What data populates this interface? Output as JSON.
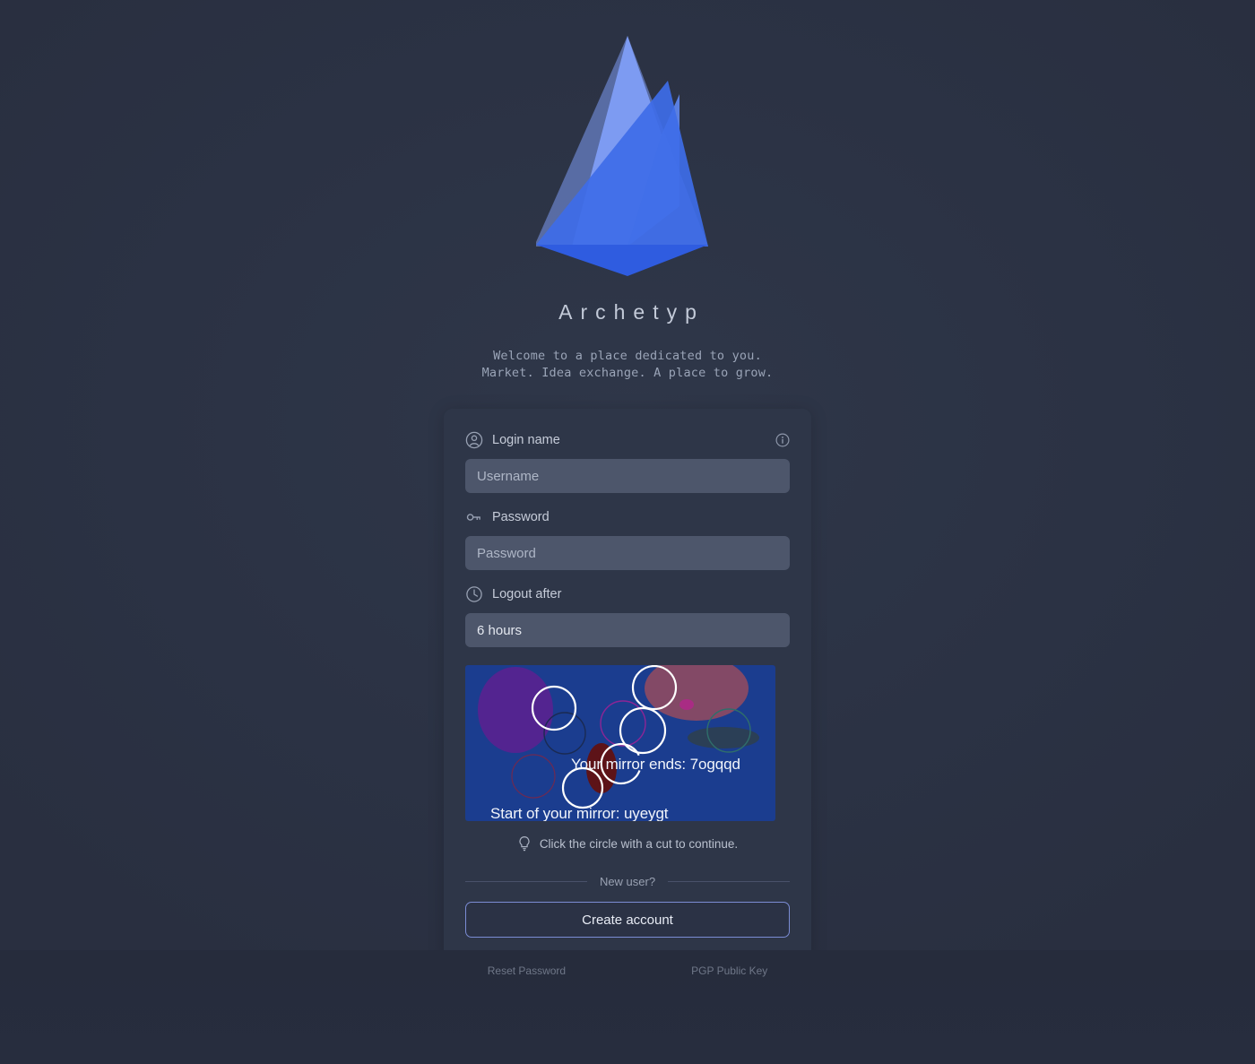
{
  "brand": {
    "title": "Archetyp",
    "tagline_line1": "Welcome to a place dedicated to you.",
    "tagline_line2": "Market. Idea exchange. A place to grow."
  },
  "logo": {
    "icon": "mountain-logo-icon",
    "color_light": "#7d9bf2",
    "color_mid": "#5a7fe0",
    "color_main": "#3e6ce8",
    "color_dark": "#2f5ce0"
  },
  "form": {
    "login": {
      "icon": "user-circle-icon",
      "label": "Login name",
      "info_icon": "info-circle-icon",
      "placeholder": "Username",
      "value": ""
    },
    "password": {
      "icon": "key-icon",
      "label": "Password",
      "placeholder": "Password",
      "value": ""
    },
    "logout_after": {
      "icon": "clock-icon",
      "label": "Logout after",
      "selected": "6 hours"
    }
  },
  "captcha": {
    "text_ends": "Your mirror ends: 7ogqqd",
    "text_start": "Start of your mirror: uyeygt",
    "background": "#1b3d8f",
    "hint_icon": "lightbulb-icon",
    "hint": "Click the circle with a cut to continue."
  },
  "signup": {
    "divider_label": "New user?",
    "button_label": "Create account"
  },
  "footer": {
    "links": [
      {
        "label": "Reset Password"
      },
      {
        "label": "PGP Public Key"
      }
    ]
  }
}
